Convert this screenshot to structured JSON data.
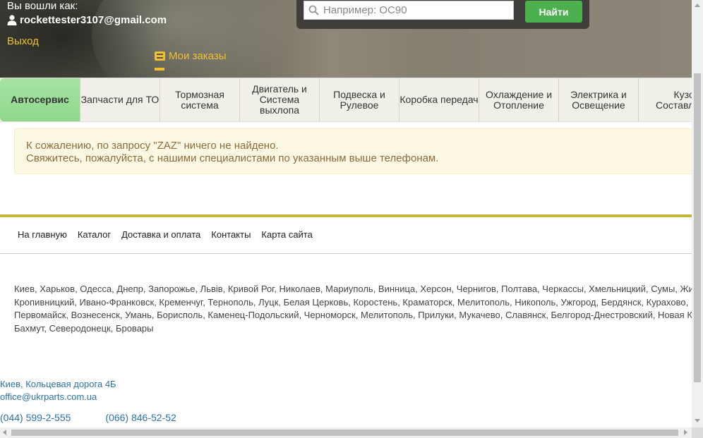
{
  "header": {
    "logged_in_label": "Вы вошли как:",
    "user_email": "rockettester3107@gmail.com",
    "logout_label": "Выход",
    "orders_label": "Мои заказы"
  },
  "search": {
    "placeholder": "Например: OC90",
    "value": "",
    "button_label": "Найти"
  },
  "tabs": [
    {
      "label": "Автосервис",
      "active": true
    },
    {
      "label": "Запчасти для ТО"
    },
    {
      "label": "Тормозная система"
    },
    {
      "label": "Двигатель и Система выхлопа"
    },
    {
      "label": "Подвеска и Рулевое"
    },
    {
      "label": "Коробка передач"
    },
    {
      "label": "Охлаждение и Отопление"
    },
    {
      "label": "Электрика и Освещение"
    },
    {
      "label": "Кузов и Составляющие"
    }
  ],
  "alert": {
    "line1": "К сожалению, по запросу \"ZAZ\" ничего не найдено.",
    "line2": "Свяжитесь, пожалуйста, с нашими специалистами по указанным выше телефонам."
  },
  "footer": {
    "nav": [
      "На главную",
      "Каталог",
      "Доставка и оплата",
      "Контакты",
      "Карта сайта"
    ],
    "cities": [
      "Киев, Харьков, Одесса, Днепр, Запорожье, Львів, Кривой Рог, Николаев, Мариуполь, Винница, Херсон, Чернигов, Полтава, Черкассы, Хмельницкий, Сумы, Житомир,",
      "Кропивницкий, Ивано-Франковск, Кременчуг, Тернополь, Луцк, Белая Церковь, Коростень, Краматорск, Мелитополь, Никополь, Ужгород, Бердянск, Курахово,",
      "Первомайск, Вознесенск, Умань, Борисполь, Каменец-Подольский, Черноморск, Мелитополь, Прилуки, Мукачево, Славянск, Белгород-Днестровский, Новая Каховка,",
      "Бахмут, Северодонецк, Бровары"
    ],
    "address": "Киев, Кольцевая дорога 4Б",
    "email": "office@ukrparts.com.ua",
    "phone1": "(044) 599-2-555",
    "phone2": "(066) 846-52-52"
  },
  "colors": {
    "accent_green": "#4cb04f",
    "active_tab": "#98dc95",
    "link_yellow": "#f0c030",
    "divider": "#c3b53a",
    "alert_bg": "#fcf8e3",
    "alert_text": "#8a6d3b",
    "link_blue": "#2a74a8"
  },
  "icons": {
    "user": "user-icon",
    "orders": "list-icon"
  }
}
